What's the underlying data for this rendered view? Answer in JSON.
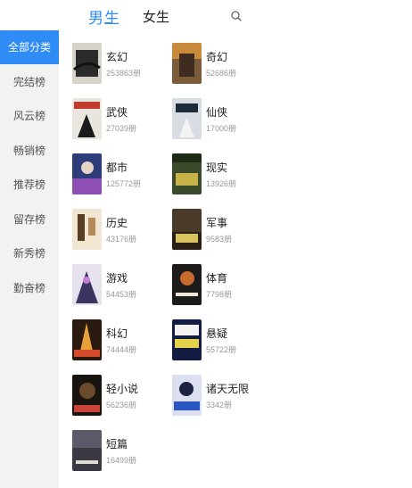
{
  "tabs": [
    {
      "label": "男生",
      "active": true
    },
    {
      "label": "女生",
      "active": false
    }
  ],
  "search": {
    "icon": "search-icon"
  },
  "sidebar": {
    "items": [
      {
        "label": "全部分类",
        "active": true
      },
      {
        "label": "完结榜",
        "active": false
      },
      {
        "label": "风云榜",
        "active": false
      },
      {
        "label": "畅销榜",
        "active": false
      },
      {
        "label": "推荐榜",
        "active": false
      },
      {
        "label": "留存榜",
        "active": false
      },
      {
        "label": "新秀榜",
        "active": false
      },
      {
        "label": "勤奋榜",
        "active": false
      }
    ]
  },
  "categories": [
    {
      "name": "玄幻",
      "count": "253863册"
    },
    {
      "name": "奇幻",
      "count": "52686册"
    },
    {
      "name": "武侠",
      "count": "27039册"
    },
    {
      "name": "仙侠",
      "count": "17000册"
    },
    {
      "name": "都市",
      "count": "125772册"
    },
    {
      "name": "现实",
      "count": "13926册"
    },
    {
      "name": "历史",
      "count": "43176册"
    },
    {
      "name": "军事",
      "count": "9583册"
    },
    {
      "name": "游戏",
      "count": "54453册"
    },
    {
      "name": "体育",
      "count": "7798册"
    },
    {
      "name": "科幻",
      "count": "74444册"
    },
    {
      "name": "悬疑",
      "count": "55722册"
    },
    {
      "name": "轻小说",
      "count": "56236册"
    },
    {
      "name": "诸天无限",
      "count": "3342册"
    },
    {
      "name": "短篇",
      "count": "16499册"
    }
  ],
  "colors": {
    "accent": "#2f8cf7",
    "sidebar_bg": "#f2f2f2"
  }
}
